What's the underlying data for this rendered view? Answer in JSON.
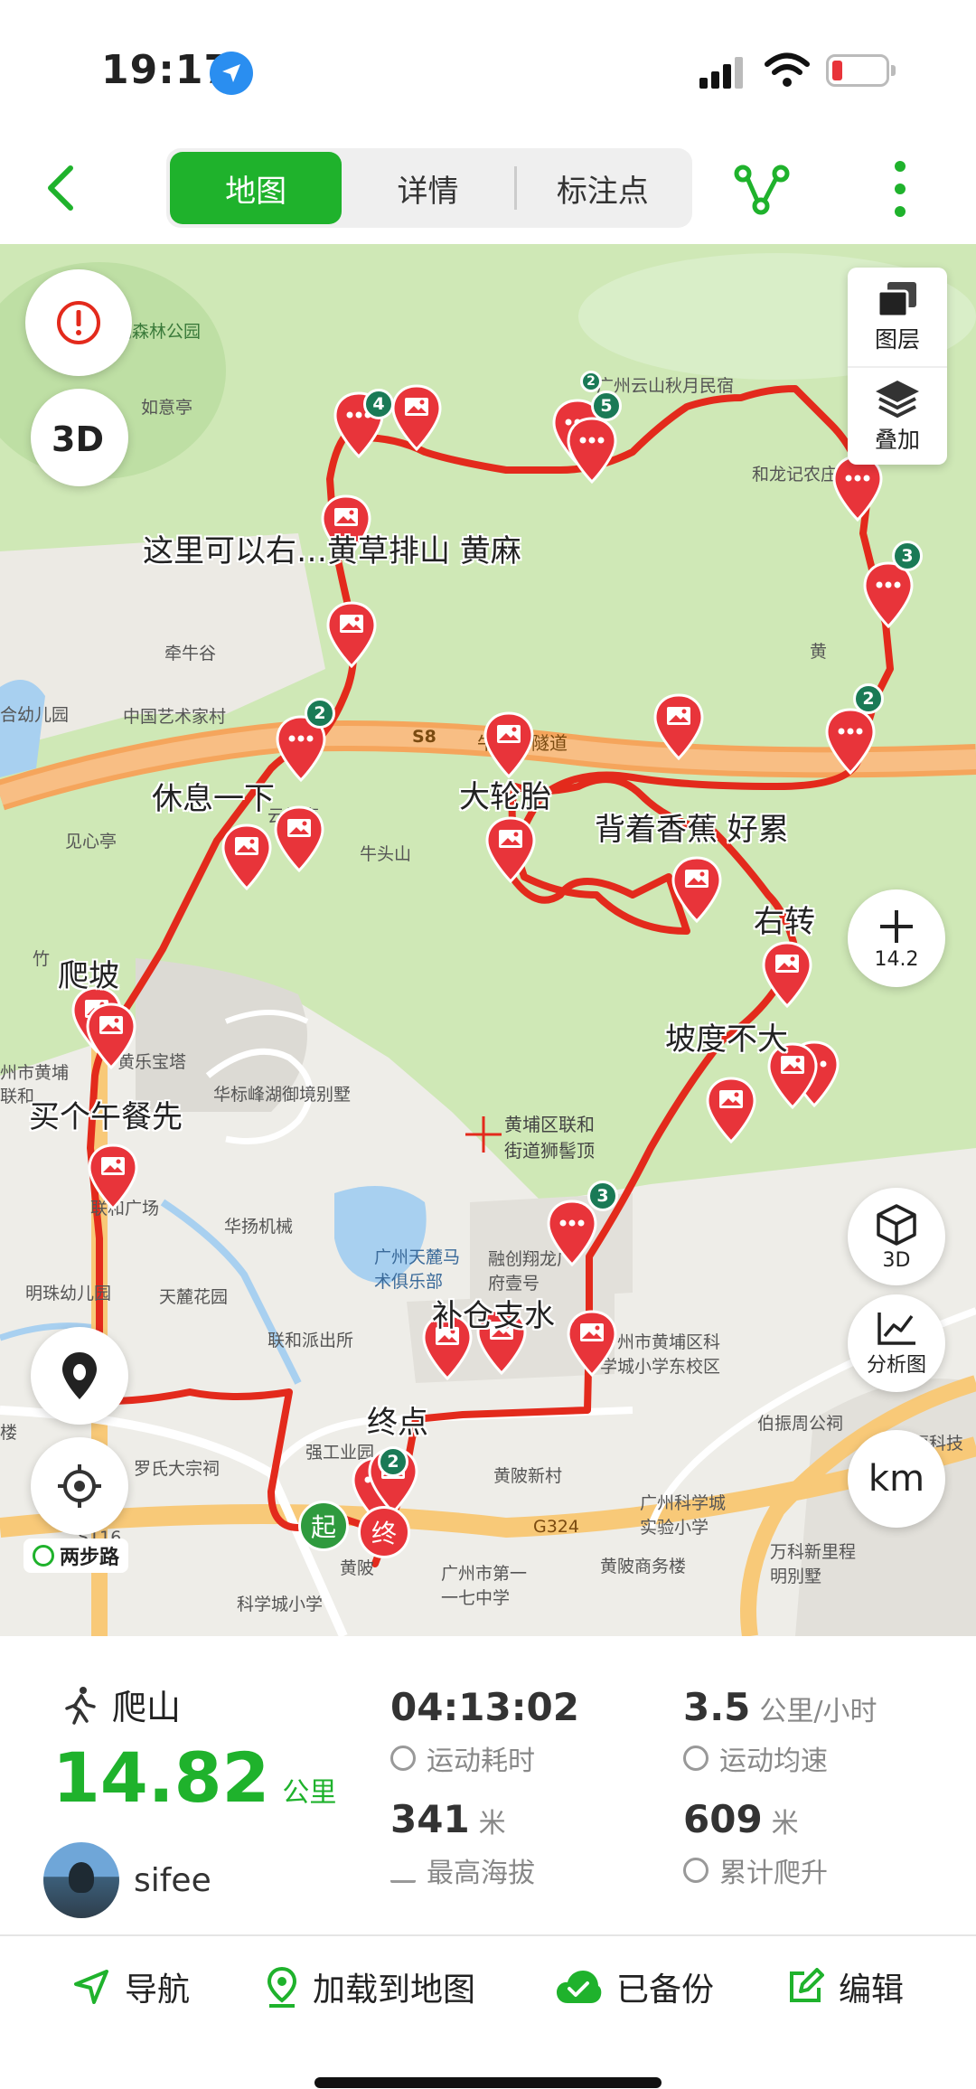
{
  "status_bar": {
    "time": "19:17"
  },
  "nav": {
    "tabs": [
      {
        "label": "地图",
        "active": true
      },
      {
        "label": "详情",
        "active": false
      },
      {
        "label": "标注点",
        "active": false
      }
    ]
  },
  "map": {
    "layer_panel": {
      "layers_label": "图层",
      "overlay_label": "叠加"
    },
    "zoom_level": "14.2",
    "buttons": {
      "btn_3d_label": "3D",
      "analysis_label": "分析图",
      "unit_label": "km"
    },
    "liangbu_label": "两步路",
    "start_label": "起",
    "end_label": "终",
    "notes": [
      "这里可以右…黄草排山 黄麻",
      "休息一下",
      "大轮胎",
      "背着香蕉 好累",
      "右转",
      "爬坡",
      "坡度不大",
      "买个午餐先",
      "补仓支水",
      "终点"
    ],
    "place_labels": [
      "鹿湖森林公园",
      "如意亭",
      "广州云山秋月民宿",
      "和龙记农庄",
      "牵牛谷",
      "中国艺术家村",
      "合幼儿园",
      "见心亭",
      "云峰亭",
      "牛头山",
      "牛鼻山隧道",
      "S8",
      "竹",
      "州市黄埔",
      "联和",
      "黄乐宝塔",
      "华标峰湖御境别墅",
      "黄埔区联和街道狮髻顶",
      "联和广场",
      "华扬机械",
      "明珠幼儿园",
      "天麓花园",
      "广州天麓马术俱乐部",
      "融创翔龙广府壹号",
      "联和派出所",
      "广州市黄埔区科学城小学东校区",
      "伯振周公祠",
      "和恒科技",
      "罗氏大宗祠",
      "强工业园",
      "黄陂新村",
      "广州科学城实验小学",
      "G324",
      "S116",
      "黄陂",
      "广州市第一一七中学",
      "黄陂商务楼",
      "科学城小学",
      "万科新里程明別墅",
      "楼",
      "黄"
    ],
    "pin_badges": [
      "4",
      "2",
      "5",
      "3",
      "2",
      "2",
      "3",
      "2"
    ],
    "colors": {
      "track": "#e32a1c",
      "pin": "#e8343a",
      "badge": "#1a7a56",
      "accent": "#1fb22c"
    }
  },
  "stats": {
    "activity": "爬山",
    "distance": "14.82",
    "distance_unit": "公里",
    "user_name": "sifee",
    "duration": {
      "value": "04:13:02",
      "label": "运动耗时"
    },
    "avg_speed": {
      "value": "3.5",
      "unit": "公里/小时",
      "label": "运动均速"
    },
    "max_altitude": {
      "value": "341",
      "unit": "米",
      "label": "最高海拔"
    },
    "total_climb": {
      "value": "609",
      "unit": "米",
      "label": "累计爬升"
    }
  },
  "actions": {
    "navigate": "导航",
    "load_to_map": "加载到地图",
    "backed_up": "已备份",
    "edit": "编辑"
  }
}
